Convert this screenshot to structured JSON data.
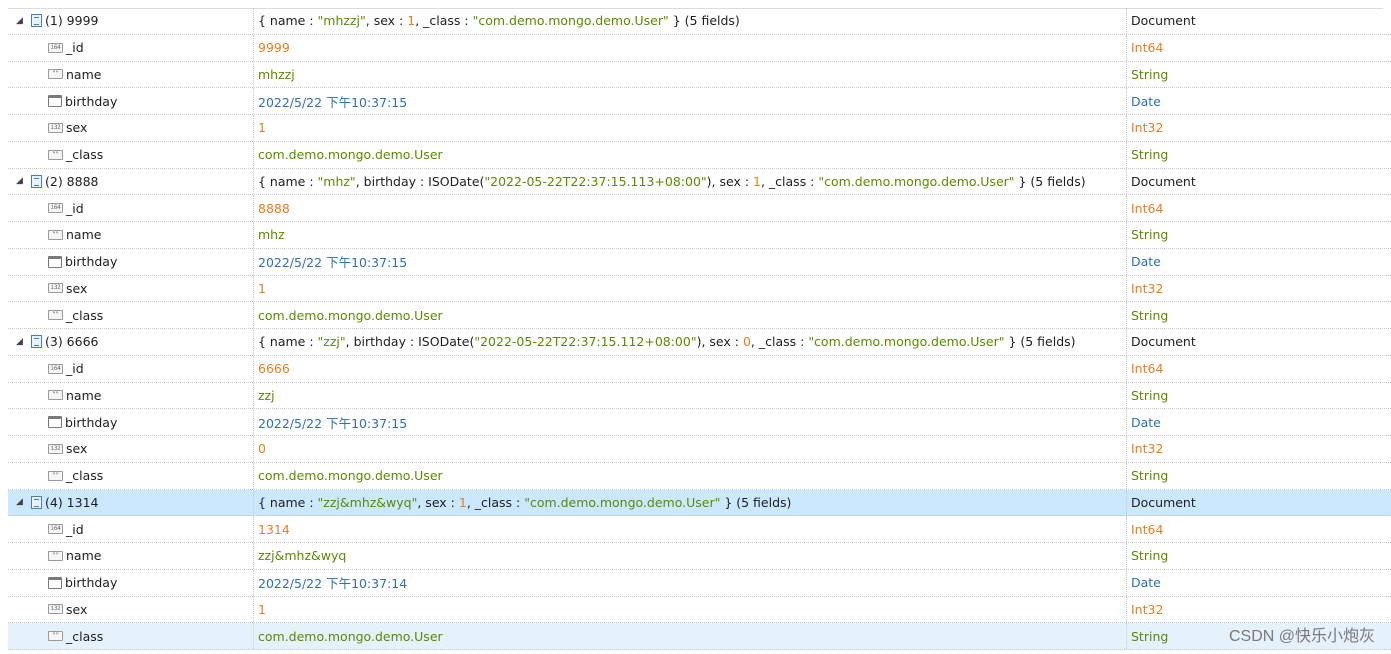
{
  "colors": {
    "number": "#e67e22",
    "string": "#5c8a00",
    "date": "#2f6fb3",
    "selected_row": "#cce8ff"
  },
  "rows": [
    {
      "kind": "doc",
      "key": "(1) 9999",
      "icon": "document-icon",
      "value": [
        [
          "{ name : ",
          "plain"
        ],
        [
          "\"mhzzj\"",
          "str"
        ],
        [
          ", sex : ",
          "plain"
        ],
        [
          "1",
          "num"
        ],
        [
          ", _class : ",
          "plain"
        ],
        [
          "\"com.demo.mongo.demo.User\"",
          "str"
        ],
        [
          " } (5 fields)",
          "plain"
        ]
      ],
      "type": "Document",
      "type_class": "plain"
    },
    {
      "kind": "field",
      "key": "_id",
      "icon": "int64-icon",
      "icon_text": "i64",
      "value": [
        [
          "9999",
          "num"
        ]
      ],
      "type": "Int64",
      "type_class": "num"
    },
    {
      "kind": "field",
      "key": "name",
      "icon": "string-icon",
      "icon_text": "\"\"",
      "value": [
        [
          "mhzzj",
          "str"
        ]
      ],
      "type": "String",
      "type_class": "str"
    },
    {
      "kind": "field",
      "key": "birthday",
      "icon": "date-icon",
      "value": [
        [
          "2022/5/22 下午10:37:15",
          "date"
        ]
      ],
      "type": "Date",
      "type_class": "date"
    },
    {
      "kind": "field",
      "key": "sex",
      "icon": "int32-icon",
      "icon_text": "i32",
      "value": [
        [
          "1",
          "num"
        ]
      ],
      "type": "Int32",
      "type_class": "num"
    },
    {
      "kind": "field",
      "key": "_class",
      "icon": "string-icon",
      "icon_text": "\"\"",
      "value": [
        [
          "com.demo.mongo.demo.User",
          "str"
        ]
      ],
      "type": "String",
      "type_class": "str"
    },
    {
      "kind": "doc",
      "key": "(2) 8888",
      "icon": "document-icon",
      "value": [
        [
          "{ name : ",
          "plain"
        ],
        [
          "\"mhz\"",
          "str"
        ],
        [
          ", birthday : ISODate(",
          "plain"
        ],
        [
          "\"2022-05-22T22:37:15.113+08:00\"",
          "str"
        ],
        [
          "), sex : ",
          "plain"
        ],
        [
          "1",
          "num"
        ],
        [
          ", _class : ",
          "plain"
        ],
        [
          "\"com.demo.mongo.demo.User\"",
          "str"
        ],
        [
          " } (5 fields)",
          "plain"
        ]
      ],
      "type": "Document",
      "type_class": "plain"
    },
    {
      "kind": "field",
      "key": "_id",
      "icon": "int64-icon",
      "icon_text": "i64",
      "value": [
        [
          "8888",
          "num"
        ]
      ],
      "type": "Int64",
      "type_class": "num"
    },
    {
      "kind": "field",
      "key": "name",
      "icon": "string-icon",
      "icon_text": "\"\"",
      "value": [
        [
          "mhz",
          "str"
        ]
      ],
      "type": "String",
      "type_class": "str"
    },
    {
      "kind": "field",
      "key": "birthday",
      "icon": "date-icon",
      "value": [
        [
          "2022/5/22 下午10:37:15",
          "date"
        ]
      ],
      "type": "Date",
      "type_class": "date"
    },
    {
      "kind": "field",
      "key": "sex",
      "icon": "int32-icon",
      "icon_text": "i32",
      "value": [
        [
          "1",
          "num"
        ]
      ],
      "type": "Int32",
      "type_class": "num"
    },
    {
      "kind": "field",
      "key": "_class",
      "icon": "string-icon",
      "icon_text": "\"\"",
      "value": [
        [
          "com.demo.mongo.demo.User",
          "str"
        ]
      ],
      "type": "String",
      "type_class": "str"
    },
    {
      "kind": "doc",
      "key": "(3) 6666",
      "icon": "document-icon",
      "value": [
        [
          "{ name : ",
          "plain"
        ],
        [
          "\"zzj\"",
          "str"
        ],
        [
          ", birthday : ISODate(",
          "plain"
        ],
        [
          "\"2022-05-22T22:37:15.112+08:00\"",
          "str"
        ],
        [
          "), sex : ",
          "plain"
        ],
        [
          "0",
          "num"
        ],
        [
          ", _class : ",
          "plain"
        ],
        [
          "\"com.demo.mongo.demo.User\"",
          "str"
        ],
        [
          " } (5 fields)",
          "plain"
        ]
      ],
      "type": "Document",
      "type_class": "plain"
    },
    {
      "kind": "field",
      "key": "_id",
      "icon": "int64-icon",
      "icon_text": "i64",
      "value": [
        [
          "6666",
          "num"
        ]
      ],
      "type": "Int64",
      "type_class": "num"
    },
    {
      "kind": "field",
      "key": "name",
      "icon": "string-icon",
      "icon_text": "\"\"",
      "value": [
        [
          "zzj",
          "str"
        ]
      ],
      "type": "String",
      "type_class": "str"
    },
    {
      "kind": "field",
      "key": "birthday",
      "icon": "date-icon",
      "value": [
        [
          "2022/5/22 下午10:37:15",
          "date"
        ]
      ],
      "type": "Date",
      "type_class": "date"
    },
    {
      "kind": "field",
      "key": "sex",
      "icon": "int32-icon",
      "icon_text": "i32",
      "value": [
        [
          "0",
          "num"
        ]
      ],
      "type": "Int32",
      "type_class": "num"
    },
    {
      "kind": "field",
      "key": "_class",
      "icon": "string-icon",
      "icon_text": "\"\"",
      "value": [
        [
          "com.demo.mongo.demo.User",
          "str"
        ]
      ],
      "type": "String",
      "type_class": "str"
    },
    {
      "kind": "doc",
      "key": "(4) 1314",
      "icon": "document-icon",
      "selected": true,
      "value": [
        [
          "{ name : ",
          "plain"
        ],
        [
          "\"zzj&mhz&wyq\"",
          "str"
        ],
        [
          ", sex : ",
          "plain"
        ],
        [
          "1",
          "num"
        ],
        [
          ", _class : ",
          "plain"
        ],
        [
          "\"com.demo.mongo.demo.User\"",
          "str"
        ],
        [
          " } (5 fields)",
          "plain"
        ]
      ],
      "type": "Document",
      "type_class": "plain"
    },
    {
      "kind": "field",
      "key": "_id",
      "icon": "int64-icon",
      "icon_text": "i64",
      "value": [
        [
          "1314",
          "num"
        ]
      ],
      "type": "Int64",
      "type_class": "num"
    },
    {
      "kind": "field",
      "key": "name",
      "icon": "string-icon",
      "icon_text": "\"\"",
      "value": [
        [
          "zzj&mhz&wyq",
          "str"
        ]
      ],
      "type": "String",
      "type_class": "str"
    },
    {
      "kind": "field",
      "key": "birthday",
      "icon": "date-icon",
      "value": [
        [
          "2022/5/22 下午10:37:14",
          "date"
        ]
      ],
      "type": "Date",
      "type_class": "date"
    },
    {
      "kind": "field",
      "key": "sex",
      "icon": "int32-icon",
      "icon_text": "i32",
      "value": [
        [
          "1",
          "num"
        ]
      ],
      "type": "Int32",
      "type_class": "num"
    },
    {
      "kind": "field",
      "key": "_class",
      "icon": "string-icon",
      "icon_text": "\"\"",
      "value": [
        [
          "com.demo.mongo.demo.User",
          "str"
        ]
      ],
      "type": "String",
      "type_class": "str",
      "hover": true
    }
  ],
  "watermark": "CSDN @快乐小炮灰"
}
